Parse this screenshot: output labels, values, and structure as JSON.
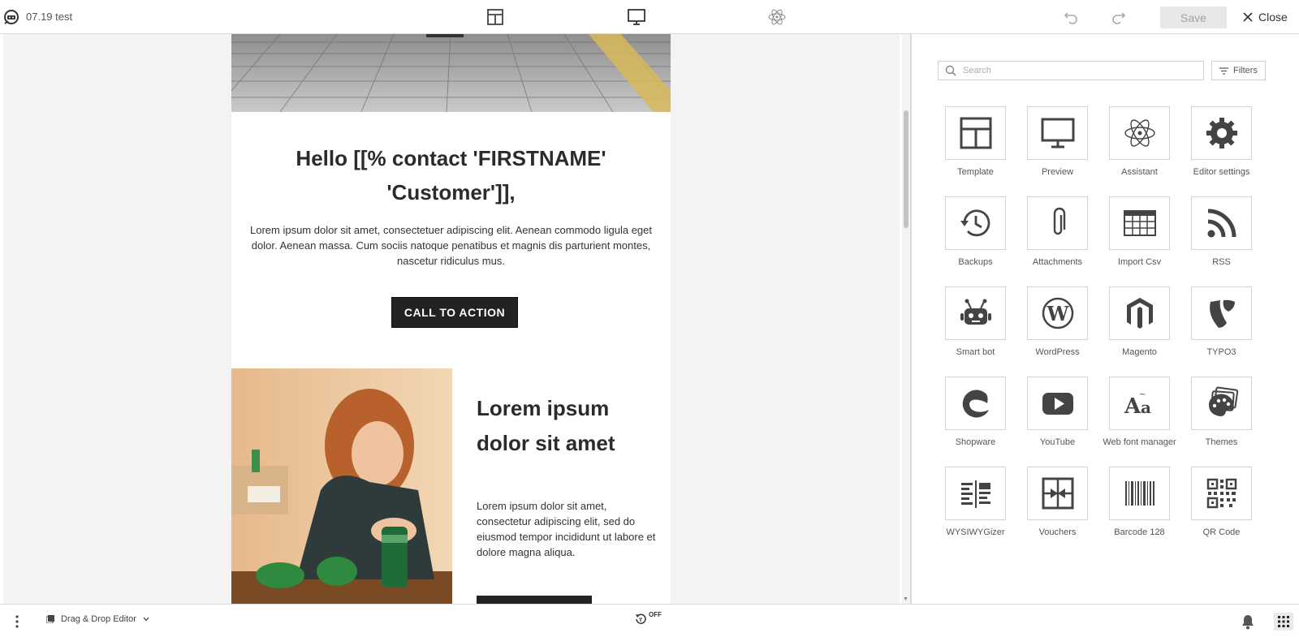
{
  "header": {
    "doc_title": "07.19 test",
    "save_label": "Save",
    "close_label": "Close"
  },
  "email": {
    "greeting": "Hello [[% contact 'FIRSTNAME' 'Customer']],",
    "lead_text": "Lorem ipsum dolor sit amet, consectetuer adipiscing elit. Aenean commodo ligula eget dolor. Aenean massa. Cum sociis natoque penatibus et magnis dis parturient montes, nascetur ridiculus mus.",
    "cta_label": "CALL TO ACTION",
    "side_heading": "Lorem ipsum dolor sit amet",
    "side_text": "Lorem ipsum dolor sit amet, consectetur adipiscing elit, sed do eiusmod tempor incididunt ut labore et dolore magna aliqua."
  },
  "panel": {
    "search_placeholder": "Search",
    "filters_label": "Filters",
    "tiles": [
      {
        "label": "Template",
        "icon": "template-icon"
      },
      {
        "label": "Preview",
        "icon": "preview-icon"
      },
      {
        "label": "Assistant",
        "icon": "atom-icon"
      },
      {
        "label": "Editor settings",
        "icon": "gear-icon"
      },
      {
        "label": "Backups",
        "icon": "history-icon"
      },
      {
        "label": "Attachments",
        "icon": "paperclip-icon"
      },
      {
        "label": "Import Csv",
        "icon": "table-icon"
      },
      {
        "label": "RSS",
        "icon": "rss-icon"
      },
      {
        "label": "Smart bot",
        "icon": "robot-icon"
      },
      {
        "label": "WordPress",
        "icon": "wordpress-icon"
      },
      {
        "label": "Magento",
        "icon": "magento-icon"
      },
      {
        "label": "TYPO3",
        "icon": "typo3-icon"
      },
      {
        "label": "Shopware",
        "icon": "shopware-icon"
      },
      {
        "label": "YouTube",
        "icon": "youtube-icon"
      },
      {
        "label": "Web font manager",
        "icon": "font-icon"
      },
      {
        "label": "Themes",
        "icon": "palette-icon"
      },
      {
        "label": "WYSIWYGizer",
        "icon": "wysiwygizer-icon"
      },
      {
        "label": "Vouchers",
        "icon": "voucher-icon"
      },
      {
        "label": "Barcode 128",
        "icon": "barcode-icon"
      },
      {
        "label": "QR Code",
        "icon": "qrcode-icon"
      }
    ]
  },
  "footer": {
    "mode_label": "Drag & Drop Editor",
    "timer_state": "OFF"
  },
  "colors": {
    "accent_dark": "#222222",
    "canvas_bg": "#f3f3f3",
    "icon_color": "#444444"
  }
}
